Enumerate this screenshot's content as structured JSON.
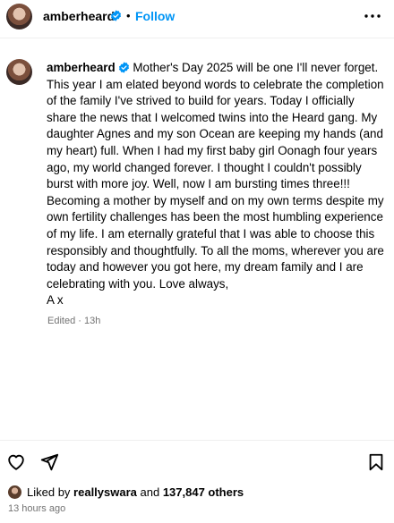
{
  "header": {
    "username": "amberheard",
    "separator": "•",
    "follow_label": "Follow",
    "more_icon": "more-horizontal-icon",
    "verified_icon": "verified-badge-icon"
  },
  "caption": {
    "username": "amberheard",
    "text": "Mother's Day 2025 will be one I'll never forget. This year I am elated beyond words to celebrate the completion of the family I've strived to build for years. Today I officially share the news that I welcomed twins into the Heard gang. My daughter Agnes and my son Ocean are keeping my hands (and my heart) full. When I had my first baby girl Oonagh four years ago, my world changed forever. I thought I couldn't possibly burst with more joy. Well, now I am bursting times three!!! Becoming a mother by myself and on my own terms despite my own fertility challenges has been the most humbling experience of my life. I am eternally grateful that I was able to choose this responsibly and thoughtfully. To all the moms, wherever you are today and however you got here, my dream family and I are celebrating with you. Love always,\nA x",
    "meta": "Edited · 13h"
  },
  "actions": {
    "like_icon": "heart-icon",
    "share_icon": "send-icon",
    "save_icon": "bookmark-icon"
  },
  "likes": {
    "prefix": "Liked by ",
    "user": "reallyswara",
    "middle": " and ",
    "count": "137,847 others"
  },
  "timestamp": "13 hours ago",
  "colors": {
    "accent": "#0095f6",
    "verified": "#0095f6",
    "muted": "#737373",
    "divider": "#efefef"
  }
}
